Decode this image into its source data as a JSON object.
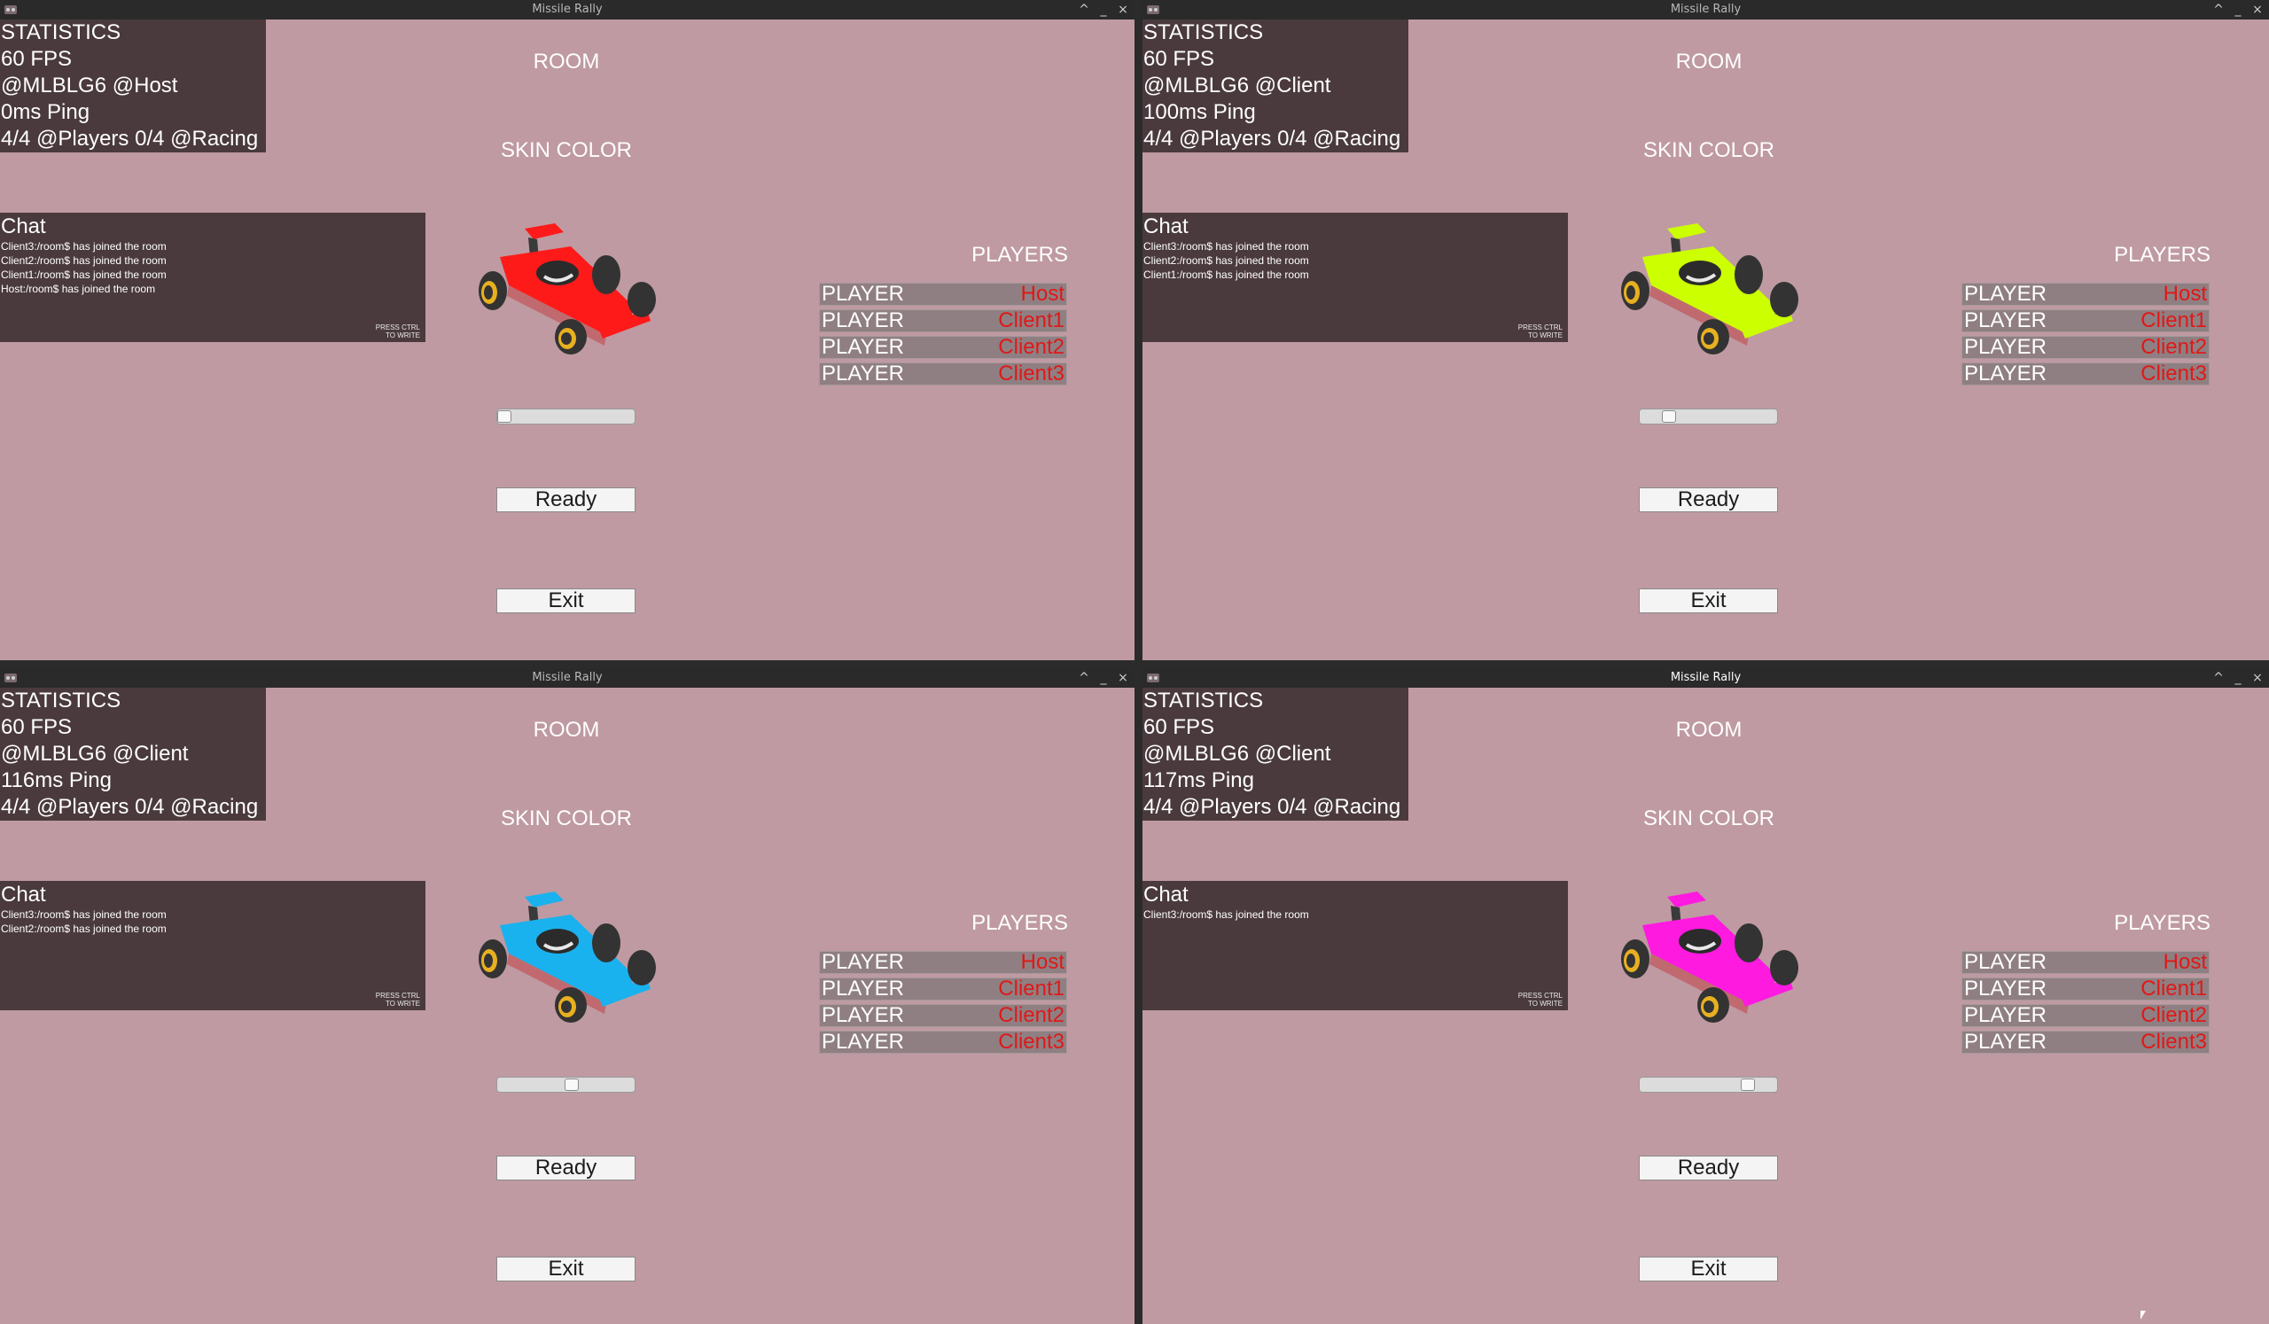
{
  "app_title": "Missile Rally",
  "labels": {
    "room": "ROOM",
    "skin_color": "SKIN COLOR",
    "players": "PLAYERS",
    "chat": "Chat",
    "chat_hint_1": "PRESS CTRL",
    "chat_hint_2": "TO WRITE",
    "ready": "Ready",
    "exit": "Exit",
    "player": "PLAYER"
  },
  "window_controls": {
    "maximize": "^",
    "minimize": "_",
    "close": "×"
  },
  "windows": [
    {
      "id": "host",
      "active": false,
      "stats": [
        "STATISTICS",
        "60 FPS",
        "@MLBLG6 @Host",
        "0ms Ping",
        "4/4 @Players 0/4 @Racing"
      ],
      "chat": [
        "Client3:/room$ has joined the room",
        "Client2:/room$ has joined the room",
        "Client1:/room$ has joined the room",
        "Host:/room$ has joined the room"
      ],
      "skin_color": "#ff1a1a",
      "skin_slider": 0.0,
      "players": [
        "Host",
        "Client1",
        "Client2",
        "Client3"
      ]
    },
    {
      "id": "client-100",
      "active": false,
      "stats": [
        "STATISTICS",
        "60 FPS",
        "@MLBLG6 @Client",
        "100ms Ping",
        "4/4 @Players 0/4 @Racing"
      ],
      "chat": [
        "Client3:/room$ has joined the room",
        "Client2:/room$ has joined the room",
        "Client1:/room$ has joined the room"
      ],
      "skin_color": "#ccff00",
      "skin_slider": 0.18,
      "players": [
        "Host",
        "Client1",
        "Client2",
        "Client3"
      ]
    },
    {
      "id": "client-116",
      "active": false,
      "stats": [
        "STATISTICS",
        "60 FPS",
        "@MLBLG6 @Client",
        "116ms Ping",
        "4/4 @Players 0/4 @Racing"
      ],
      "chat": [
        "Client3:/room$ has joined the room",
        "Client2:/room$ has joined the room"
      ],
      "skin_color": "#1ab2ee",
      "skin_slider": 0.55,
      "players": [
        "Host",
        "Client1",
        "Client2",
        "Client3"
      ]
    },
    {
      "id": "client-117",
      "active": true,
      "stats": [
        "STATISTICS",
        "60 FPS",
        "@MLBLG6 @Client",
        "117ms Ping",
        "4/4 @Players 0/4 @Racing"
      ],
      "chat": [
        "Client3:/room$ has joined the room"
      ],
      "skin_color": "#ff1ae0",
      "skin_slider": 0.82,
      "players": [
        "Host",
        "Client1",
        "Client2",
        "Client3"
      ]
    }
  ]
}
